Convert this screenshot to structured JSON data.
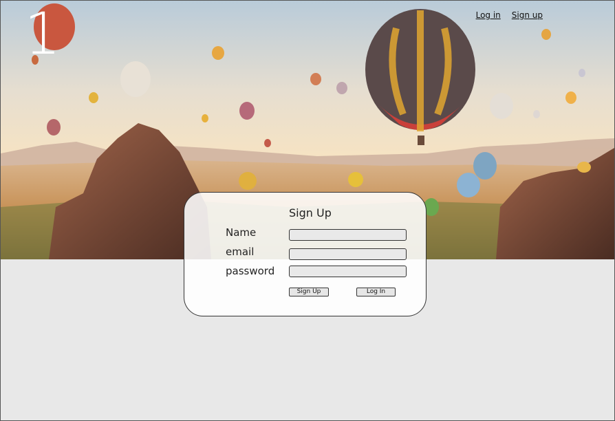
{
  "step_number": "1",
  "top_nav": {
    "login_label": "Log in",
    "signup_label": "Sign up"
  },
  "form": {
    "title": "Sign Up",
    "fields": [
      {
        "label": "Name",
        "value": "",
        "placeholder": ""
      },
      {
        "label": "email",
        "value": "",
        "placeholder": ""
      },
      {
        "label": "password",
        "value": "",
        "placeholder": ""
      }
    ],
    "signup_button": "Sign Up",
    "login_button": "Log In"
  },
  "hero_image": {
    "subject": "hot air balloons over rocky valley at sunrise"
  },
  "colors": {
    "page_background": "#e8e8e8",
    "border": "#333333",
    "field_background": "#e9e9e9"
  }
}
